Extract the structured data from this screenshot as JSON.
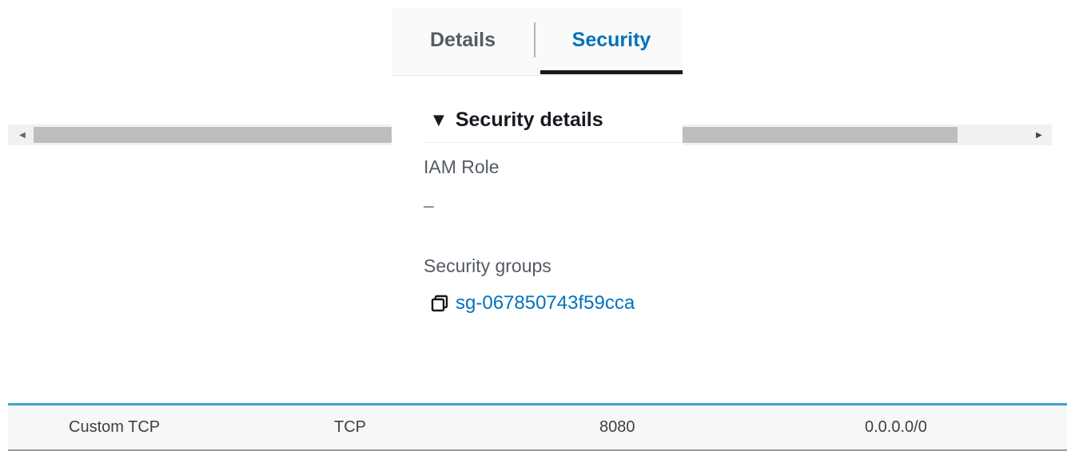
{
  "tabs": [
    {
      "label": "Details"
    },
    {
      "label": "Security"
    }
  ],
  "security_details": {
    "section_title": "Security details",
    "iam_role_label": "IAM Role",
    "iam_role_value": "–",
    "security_groups_label": "Security groups",
    "security_group_id": "sg-067850743f59cca"
  },
  "rule_row": {
    "type": "Custom TCP",
    "protocol": "TCP",
    "port_range": "8080",
    "source": "0.0.0.0/0"
  },
  "colors": {
    "link": "#0073bb",
    "active_tab_underline": "#16191f",
    "row_highlight": "#3aa6cc"
  },
  "icons": {
    "collapse": "caret-down-icon",
    "copy": "copy-icon",
    "scroll_left": "arrow-left-icon",
    "scroll_right": "arrow-right-icon"
  }
}
